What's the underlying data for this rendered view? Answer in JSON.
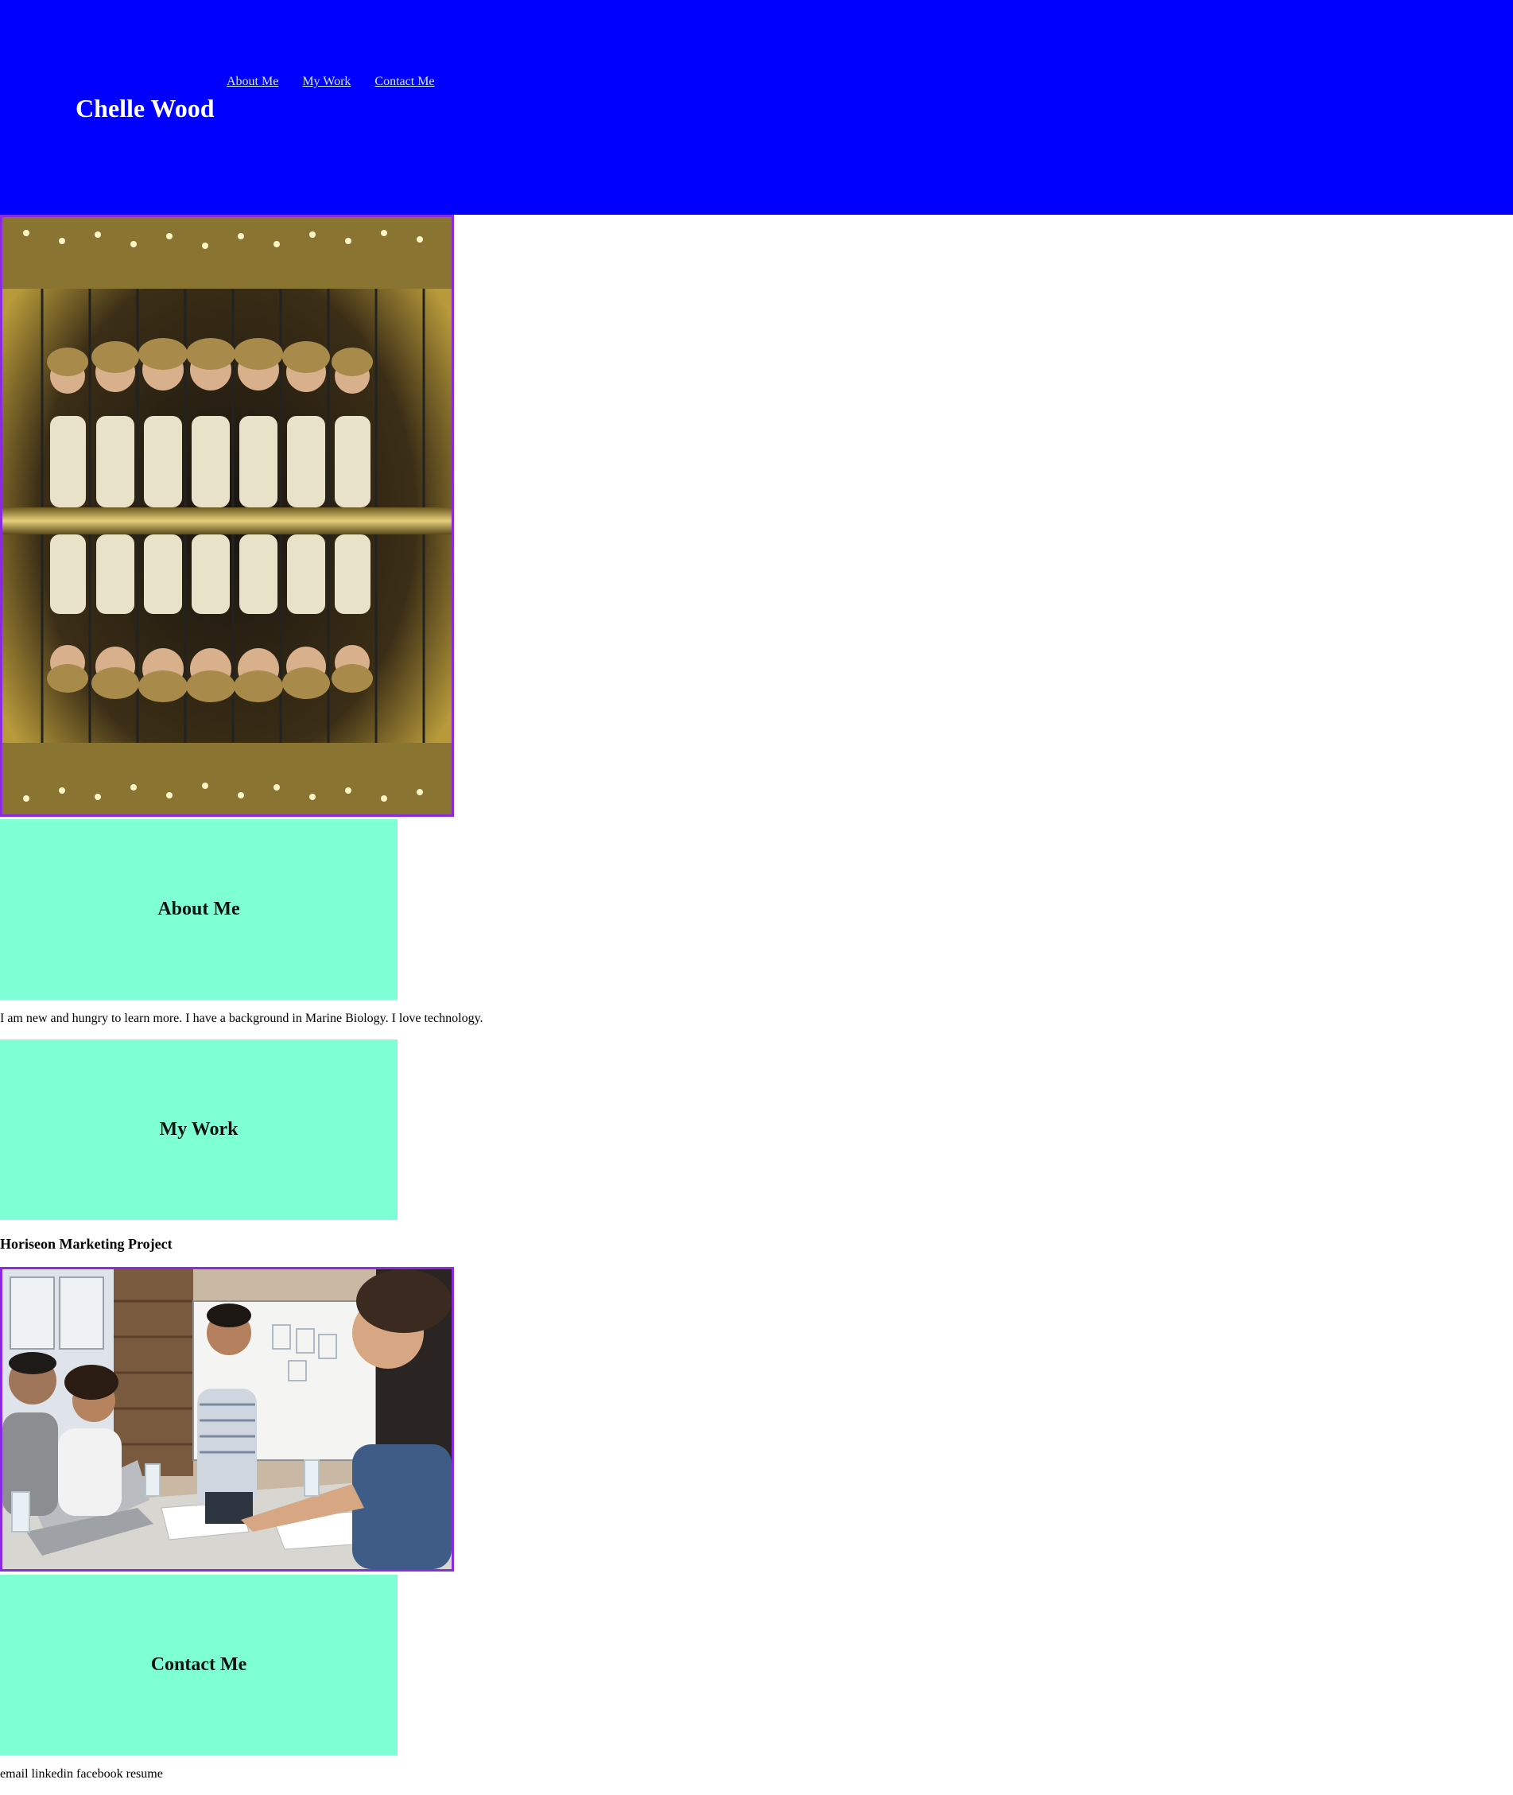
{
  "header": {
    "site_title": "Chelle Wood",
    "nav": [
      {
        "label": "About Me"
      },
      {
        "label": "My Work"
      },
      {
        "label": "Contact Me"
      }
    ],
    "background_color": "#0000ff"
  },
  "sections": {
    "about": {
      "heading": "About Me",
      "text": "I am new and hungry to learn more. I have a background in Marine Biology. I love technology."
    },
    "work": {
      "heading": "My Work",
      "project_title": "Horiseon Marketing Project"
    },
    "contact": {
      "heading": "Contact Me",
      "links": [
        "email",
        "linkedin",
        "facebook",
        "resume"
      ]
    }
  },
  "colors": {
    "banner": "#7fffd4",
    "image_border": "#8a2be2",
    "nav_link": "#cfe6ff"
  }
}
